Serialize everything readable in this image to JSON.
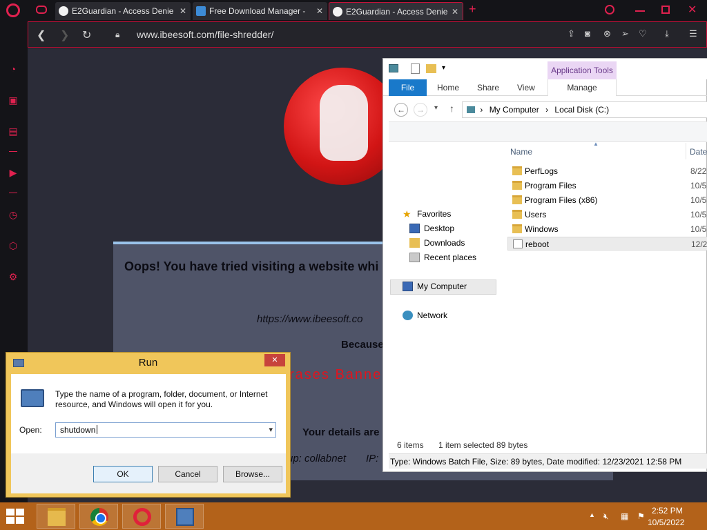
{
  "browser": {
    "tabs": [
      {
        "title": "E2Guardian - Access Denie",
        "close": "✕"
      },
      {
        "title": "Free Download Manager -",
        "close": "✕"
      },
      {
        "title": "E2Guardian - Access Denie",
        "close": "✕"
      }
    ],
    "new_tab": "+",
    "url": "www.ibeesoft.com/file-shredder/",
    "accent": "#e0214f"
  },
  "blocked_page": {
    "title": "Oops! You have tried visiting a website whi",
    "url": "https://www.ibeesoft.co",
    "because": "Because",
    "reason": "rases  Banne",
    "details": "Your details are",
    "group": "up: collabnet",
    "ip": "IP:"
  },
  "explorer": {
    "application_tools": "Application Tools",
    "ribbon_tabs": {
      "file": "File",
      "home": "Home",
      "share": "Share",
      "view": "View",
      "manage": "Manage"
    },
    "breadcrumb": {
      "root": "My Computer",
      "sep": "›",
      "current": "Local Disk (C:)"
    },
    "nav_pane": {
      "favorites": "Favorites",
      "desktop": "Desktop",
      "downloads": "Downloads",
      "recent": "Recent places",
      "my_computer": "My Computer",
      "network": "Network"
    },
    "columns": {
      "name": "Name",
      "date": "Date"
    },
    "files": [
      {
        "name": "PerfLogs",
        "date": "8/22,"
      },
      {
        "name": "Program Files",
        "date": "10/5,"
      },
      {
        "name": "Program Files (x86)",
        "date": "10/5,"
      },
      {
        "name": "Users",
        "date": "10/5,"
      },
      {
        "name": "Windows",
        "date": "10/5,"
      },
      {
        "name": "reboot",
        "date": "12/2"
      }
    ],
    "status": {
      "count": "6 items",
      "selected": "1 item selected  89 bytes"
    },
    "details": "Type: Windows Batch File, Size: 89 bytes, Date modified: 12/23/2021 12:58 PM"
  },
  "run_dialog": {
    "title": "Run",
    "close": "✕",
    "description": "Type the name of a program, folder, document, or Internet resource, and Windows will open it for you.",
    "open_label": "Open:",
    "input_value": "shutdown",
    "dropdown": "▾",
    "ok": "OK",
    "cancel": "Cancel",
    "browse": "Browse..."
  },
  "taskbar": {
    "time": "2:52 PM",
    "date": "10/5/2022",
    "color": "#b3621a"
  }
}
